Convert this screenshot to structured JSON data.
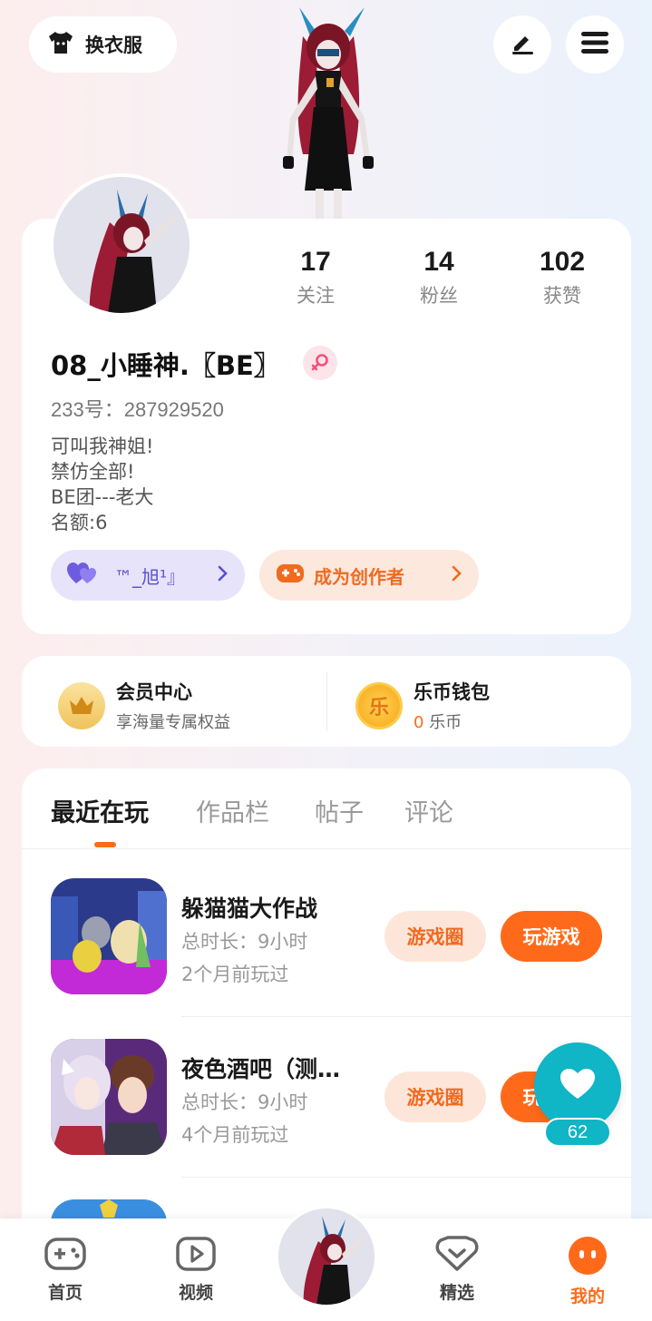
{
  "header": {
    "outfit_label": "换衣服"
  },
  "profile": {
    "stats": [
      {
        "num": "17",
        "label": "关注"
      },
      {
        "num": "14",
        "label": "粉丝"
      },
      {
        "num": "102",
        "label": "获赞"
      }
    ],
    "username": "08_小睡神.〖BE〗",
    "uid": "233号：287929520",
    "bio": [
      "可叫我神姐!",
      "禁仿全部!",
      "BE团---老大",
      "名额:6"
    ],
    "friend_pill": "™_旭¹』",
    "creator_pill": "成为创作者"
  },
  "member": {
    "vip_title": "会员中心",
    "vip_sub": "享海量专属权益",
    "wallet_title": "乐币钱包",
    "wallet_amount": "0",
    "wallet_unit": "乐币",
    "wallet_icon_char": "乐"
  },
  "tabs": [
    "最近在玩",
    "作品栏",
    "帖子",
    "评论"
  ],
  "games": [
    {
      "name": "躲猫猫大作战",
      "duration": "总时长：9小时",
      "last": "2个月前玩过",
      "circle": "游戏圈",
      "play": "玩游戏"
    },
    {
      "name": "夜色酒吧（测…",
      "duration": "总时长：9小时",
      "last": "4个月前玩过",
      "circle": "游戏圈",
      "play": "玩游戏"
    }
  ],
  "fab": {
    "count": "62"
  },
  "nav": [
    {
      "label": "首页"
    },
    {
      "label": "视频"
    },
    {
      "label": "精选"
    },
    {
      "label": "我的"
    }
  ]
}
